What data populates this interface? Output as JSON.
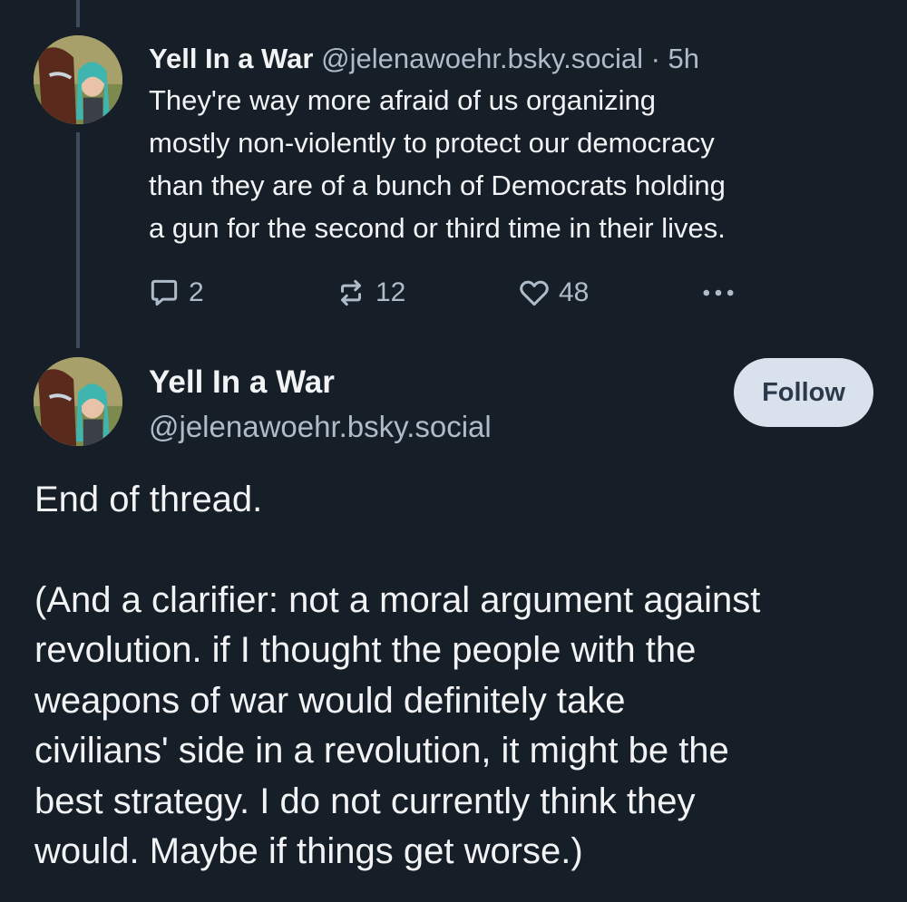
{
  "thread": {
    "parent_post": {
      "author_name": "Yell In a War",
      "author_handle": "@jelenawoehr.bsky.social",
      "separator": "·",
      "time": "5h",
      "text_lines": [
        "They're way more afraid of us organizing",
        "mostly non-violently to protect our democracy",
        "than they are of a bunch of Democrats holding",
        "a gun for the second or third time in their lives."
      ],
      "actions": {
        "reply_count": "2",
        "repost_count": "12",
        "like_count": "48",
        "more_icon": "ellipsis-icon"
      }
    },
    "main_post": {
      "author_name": "Yell In a War",
      "author_handle": "@jelenawoehr.bsky.social",
      "follow_label": "Follow",
      "paragraph1": "End of thread.",
      "paragraph2_lines": [
        "(And a clarifier: not a moral argument against",
        "revolution. if I thought the people with the",
        "weapons of war would definitely take",
        "civilians' side in a revolution, it might be the",
        "best strategy. I do not currently think they",
        "would. Maybe if things get worse.)"
      ]
    }
  },
  "colors": {
    "background": "#161e27",
    "text": "#f1f3f5",
    "muted": "#aebbc9",
    "thread_line": "#3b4b5c",
    "follow_bg": "#d9e2ec"
  }
}
